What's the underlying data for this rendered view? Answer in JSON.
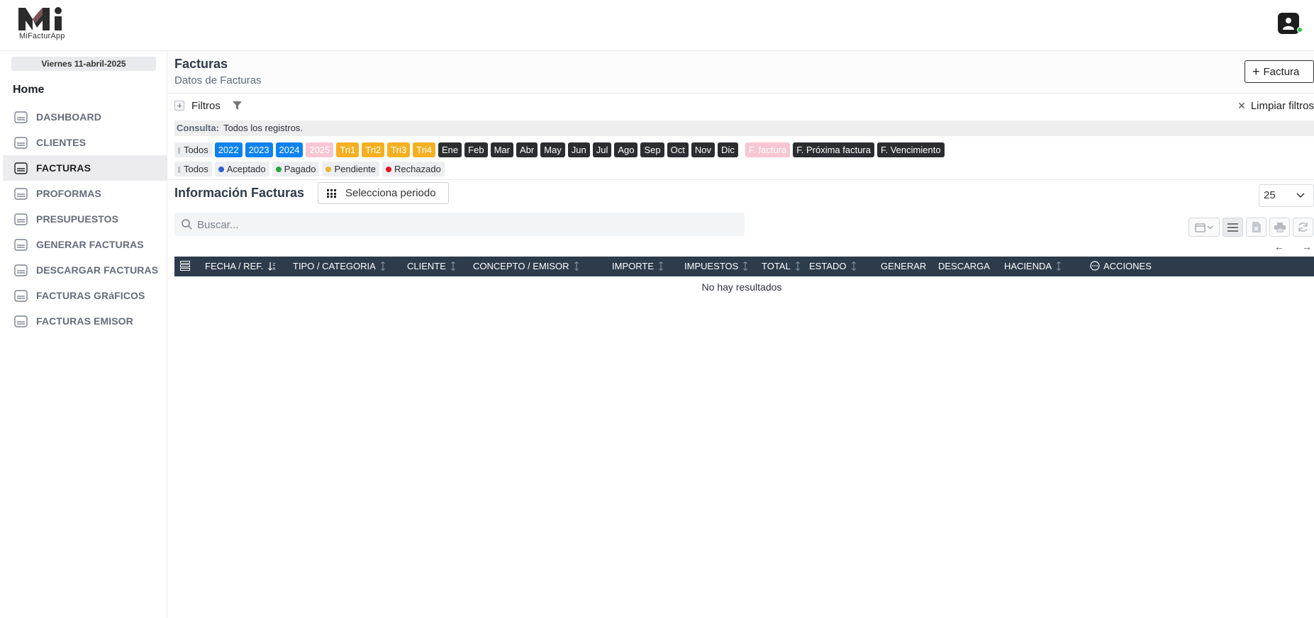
{
  "app": {
    "name": "MiFacturApp",
    "logo_mark": "Mi"
  },
  "sidebar": {
    "date": "Viernes 11-abril-2025",
    "home": "Home",
    "items": [
      {
        "label": "DASHBOARD"
      },
      {
        "label": "CLIENTES"
      },
      {
        "label": "FACTURAS"
      },
      {
        "label": "PROFORMAS"
      },
      {
        "label": "PRESUPUESTOS"
      },
      {
        "label": "GENERAR FACTURAS"
      },
      {
        "label": "DESCARGAR FACTURAS"
      },
      {
        "label": "FACTURAS GRáFICOS"
      },
      {
        "label": "FACTURAS EMISOR"
      }
    ],
    "active": "FACTURAS"
  },
  "header": {
    "title": "Facturas",
    "subtitle": "Datos de Facturas",
    "add_button": "Factura"
  },
  "filters": {
    "label": "Filtros",
    "clear_label": "Limpiar filtros",
    "query_label": "Consulta:",
    "query_value": "Todos los registros.",
    "all_label": "Todos",
    "years": [
      "2022",
      "2023",
      "2024",
      "2025"
    ],
    "inactive_year": "2025",
    "quarters": [
      "Tri1",
      "Tri2",
      "Tri3",
      "Tri4"
    ],
    "months": [
      "Ene",
      "Feb",
      "Mar",
      "Abr",
      "May",
      "Jun",
      "Jul",
      "Ago",
      "Sep",
      "Oct",
      "Nov",
      "Dic"
    ],
    "date_fields": [
      "F. factura",
      "F. Próxima factura",
      "F. Vencimiento"
    ],
    "inactive_date_field": "F. factura",
    "statuses": [
      {
        "label": "Aceptado",
        "color": "#2f5fd0"
      },
      {
        "label": "Pagado",
        "color": "#2aa544"
      },
      {
        "label": "Pendiente",
        "color": "#e5b62b"
      },
      {
        "label": "Rechazado",
        "color": "#e0161f"
      }
    ]
  },
  "table": {
    "section_title": "Información Facturas",
    "period_button": "Selecciona periodo",
    "page_size": "25",
    "search_placeholder": "Buscar...",
    "columns": [
      "FECHA / REF.",
      "TIPO / CATEGORIA",
      "CLIENTE",
      "CONCEPTO / EMISOR",
      "IMPORTE",
      "IMPUESTOS",
      "TOTAL",
      "ESTADO",
      "GENERAR",
      "DESCARGA",
      "HACIENDA",
      "ACCIONES"
    ],
    "empty_message": "No hay resultados"
  },
  "colors": {
    "year_active": "#0d82f0",
    "year_inactive": "#f7c6d3",
    "quarter": "#f5b021",
    "month": "#2b2d30",
    "table_header": "#2d3b4b",
    "online": "#27c24c"
  }
}
